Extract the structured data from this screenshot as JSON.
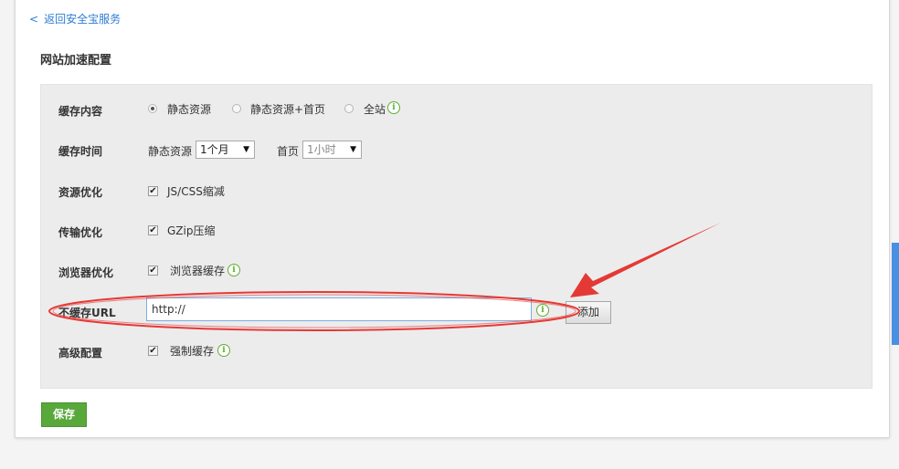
{
  "nav": {
    "back_chevron": "<",
    "back_label": "返回安全宝服务"
  },
  "page": {
    "title": "网站加速配置"
  },
  "cache_content": {
    "label": "缓存内容",
    "options": [
      "静态资源",
      "静态资源+首页",
      "全站"
    ],
    "selected_index": 0
  },
  "cache_time": {
    "label": "缓存时间",
    "static_label": "静态资源",
    "static_value": "1个月",
    "home_label": "首页",
    "home_value": "1小时"
  },
  "resource_opt": {
    "label": "资源优化",
    "option": "JS/CSS缩减",
    "checked": true
  },
  "transfer_opt": {
    "label": "传输优化",
    "option": "GZip压缩",
    "checked": true
  },
  "browser_opt": {
    "label": "浏览器优化",
    "option": "浏览器缓存",
    "checked": true
  },
  "no_cache_url": {
    "label": "不缓存URL",
    "value": "http://",
    "add_label": "添加"
  },
  "advanced": {
    "label": "高级配置",
    "option": "强制缓存",
    "checked": true
  },
  "save_label": "保存",
  "icons": {
    "info": "i",
    "caret": "▼",
    "check": "✔"
  },
  "colors": {
    "link": "#2d7dd2",
    "save_button": "#59a83c",
    "info_icon": "#5fae2f",
    "annotation": "#e53935",
    "input_border": "#7aaee0"
  }
}
